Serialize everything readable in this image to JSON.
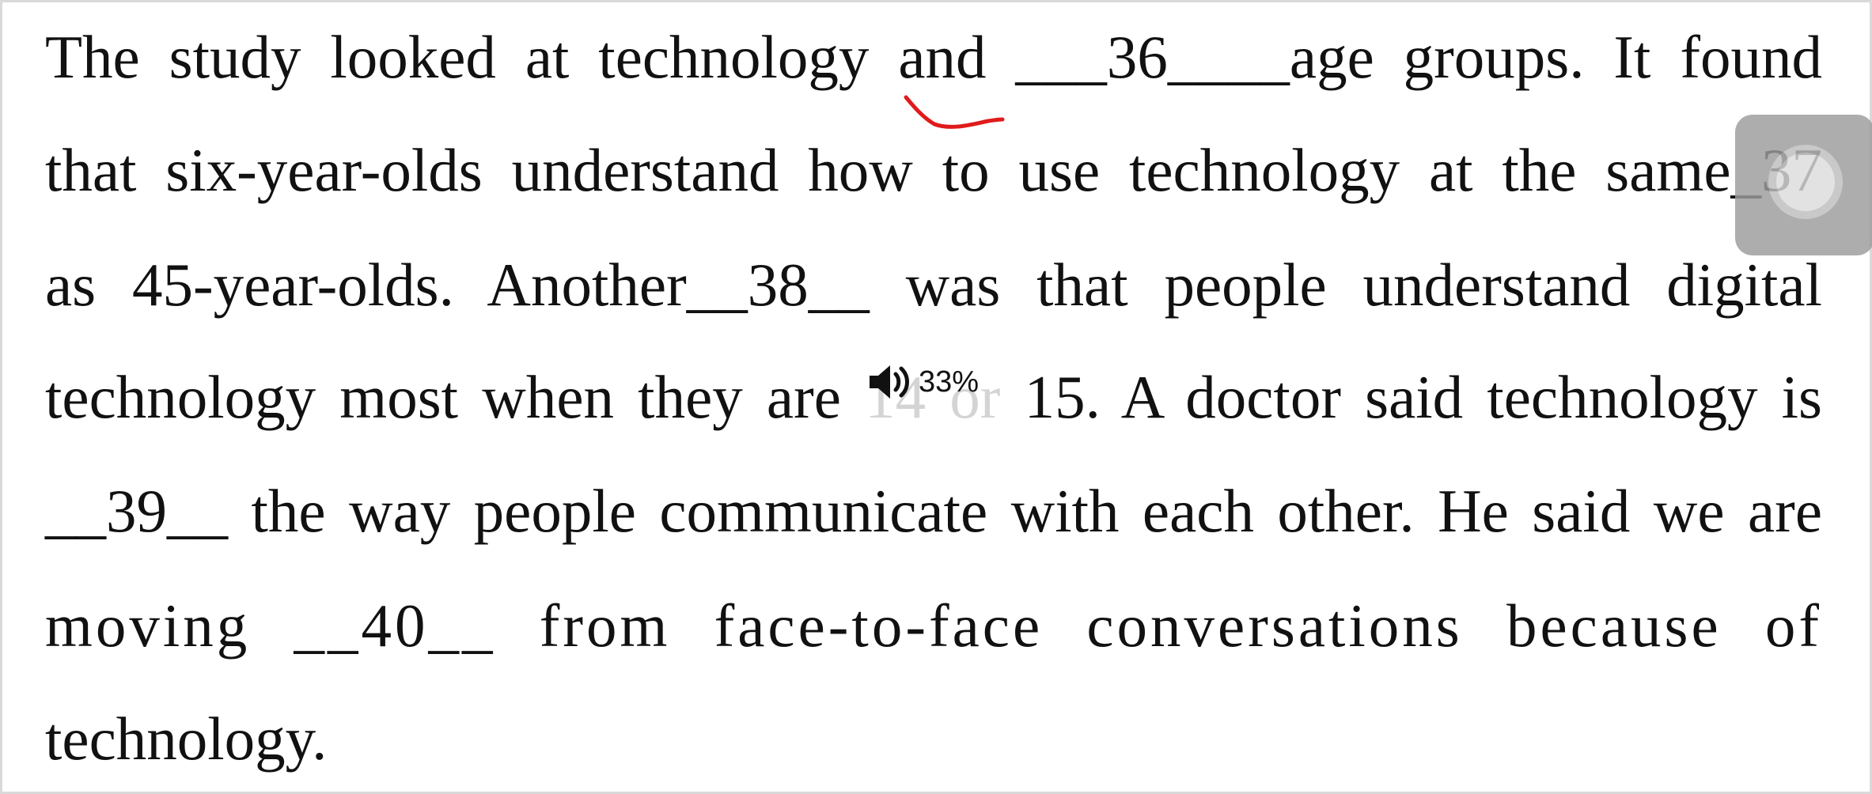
{
  "passage": {
    "lines": [
      "The study looked at technology and ___36____age groups. It found",
      "that six-year-olds understand how to use technology at the same_37",
      "as 45-year-olds. Another__38__ was that people understand digital",
      "technology most when they are",
      "14 or",
      "15. A doctor said technology is",
      "__39__ the way people communicate with each other. He said we are",
      "moving __40__ from face-to-face conversations because of",
      "technology."
    ]
  },
  "audio": {
    "percent": "33%",
    "icon": "speaker-icon"
  },
  "overlay": {
    "icon": "assistive-touch-icon"
  },
  "annotation": {
    "color": "#e01b1b"
  }
}
